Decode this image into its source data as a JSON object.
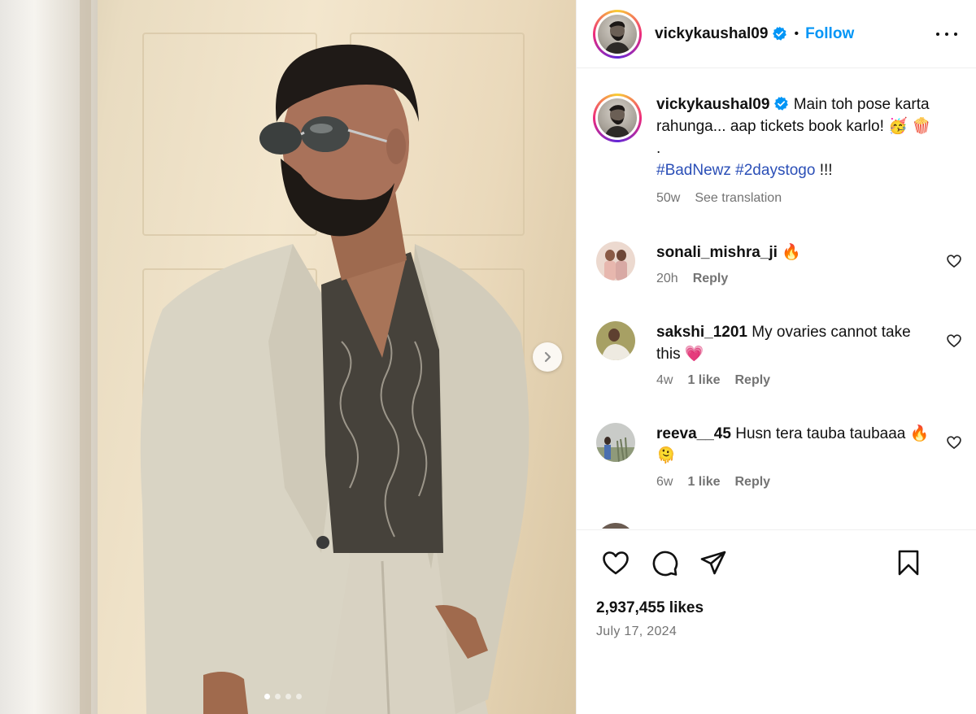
{
  "header": {
    "username": "vickykaushal09",
    "separator": "•",
    "follow_label": "Follow",
    "more_icon": "more-options-icon"
  },
  "caption": {
    "username": "vickykaushal09",
    "text": "Main toh pose karta rahunga... aap tickets book karlo! 🥳 🍿",
    "dot_line": ".",
    "hashtag1": "#BadNewz",
    "hashtag2": "#2daystogo",
    "suffix": " !!!",
    "time": "50w",
    "see_translation": "See translation"
  },
  "comments": [
    {
      "username": "sonali_mishra_ji",
      "text": " 🔥",
      "time": "20h",
      "likes": "",
      "reply": "Reply"
    },
    {
      "username": "sakshi_1201",
      "text": " My ovaries cannot take this 💗",
      "time": "4w",
      "likes": "1 like",
      "reply": "Reply"
    },
    {
      "username": "reeva__45",
      "text": " Husn tera tauba taubaaa 🔥 🫠",
      "time": "6w",
      "likes": "1 like",
      "reply": "Reply"
    }
  ],
  "footer": {
    "likes": "2,937,455 likes",
    "date": "July 17, 2024"
  },
  "carousel": {
    "current": 1,
    "total": 4
  },
  "colors": {
    "accent": "#0095f6",
    "hashtag": "#2b4fb7",
    "muted": "#737373"
  }
}
